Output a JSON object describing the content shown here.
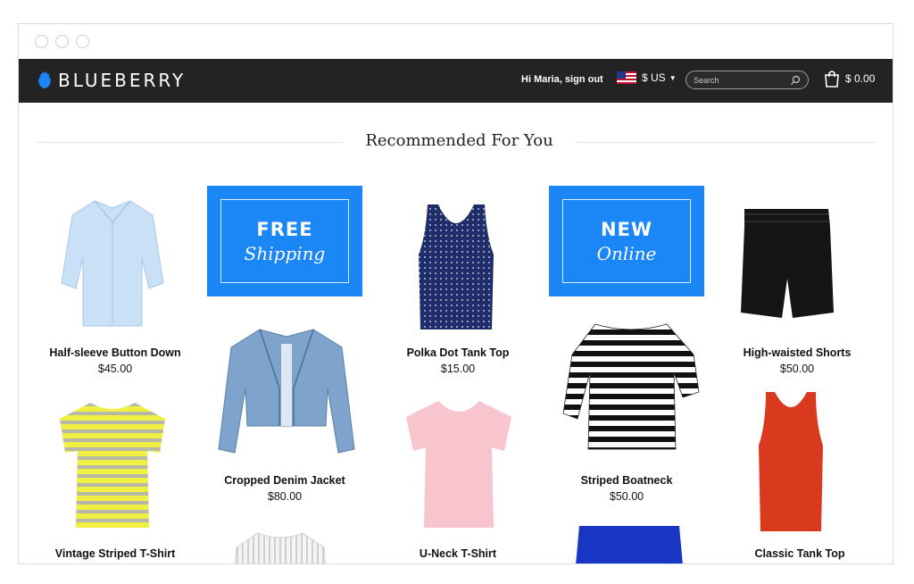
{
  "brand": {
    "name": "BLUEBERRY"
  },
  "header": {
    "greeting_prefix": "Hi ",
    "user_name": "Maria",
    "sign_out": ", sign out",
    "currency": "$ US",
    "search_placeholder": "Search",
    "cart_total": "$ 0.00"
  },
  "section": {
    "title": "Recommended For You"
  },
  "promos": [
    {
      "big": "FREE",
      "small": "Shipping"
    },
    {
      "big": "NEW",
      "small": "Online"
    }
  ],
  "products": [
    {
      "name": "Half-sleeve Button Down",
      "price": "$45.00"
    },
    {
      "name": "Polka Dot Tank Top",
      "price": "$15.00"
    },
    {
      "name": "High-waisted Shorts",
      "price": "$50.00"
    },
    {
      "name": "Cropped Denim Jacket",
      "price": "$80.00"
    },
    {
      "name": "Striped Boatneck",
      "price": "$50.00"
    },
    {
      "name": "Vintage Striped T-Shirt",
      "price": ""
    },
    {
      "name": "U-Neck T-Shirt",
      "price": ""
    },
    {
      "name": "Classic Tank Top",
      "price": ""
    }
  ],
  "colors": {
    "accent": "#1b86f5",
    "navbar": "#232323"
  }
}
